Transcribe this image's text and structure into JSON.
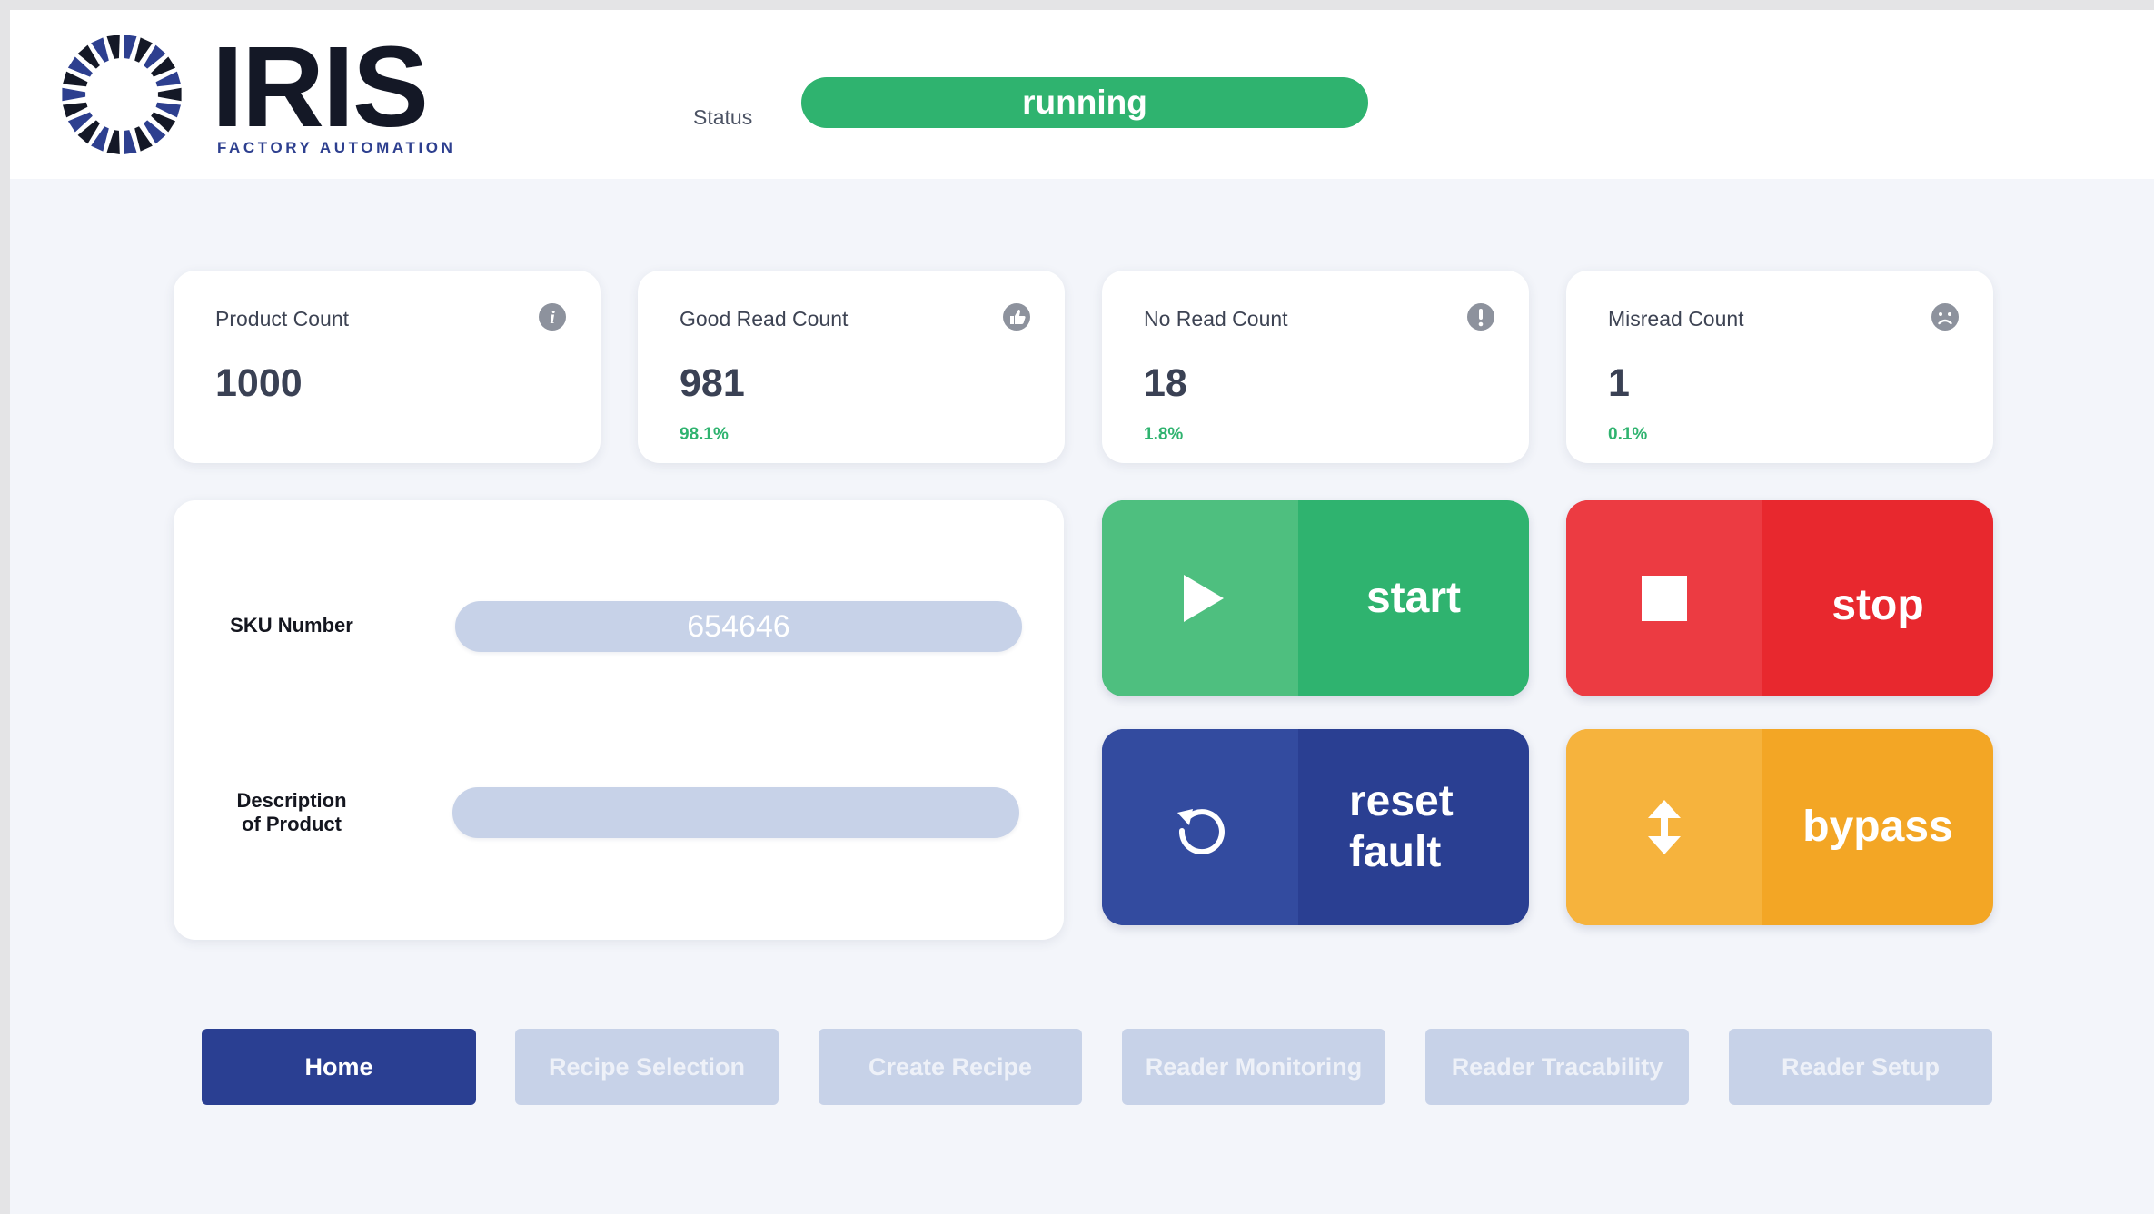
{
  "header": {
    "logo_word": "IRIS",
    "logo_sub": "FACTORY AUTOMATION",
    "status_label": "Status",
    "status_value": "running"
  },
  "metrics": [
    {
      "title": "Product Count",
      "value": "1000",
      "pct": "",
      "icon": "info-icon"
    },
    {
      "title": "Good Read Count",
      "value": "981",
      "pct": "98.1%",
      "icon": "thumbs-up-icon"
    },
    {
      "title": "No Read Count",
      "value": "18",
      "pct": "1.8%",
      "icon": "exclamation-icon"
    },
    {
      "title": "Misread Count",
      "value": "1",
      "pct": "0.1%",
      "icon": "sad-face-icon"
    }
  ],
  "form": {
    "sku_label": "SKU Number",
    "sku_value": "654646",
    "desc_label_line1": "Description",
    "desc_label_line2": "of Product",
    "desc_value": ""
  },
  "controls": {
    "start": "start",
    "stop": "stop",
    "reset_line1": "reset",
    "reset_line2": "fault",
    "bypass": "bypass"
  },
  "nav": [
    "Home",
    "Recipe Selection",
    "Create Recipe",
    "Reader Monitoring",
    "Reader Tracability",
    "Reader Setup"
  ],
  "colors": {
    "green": "#2fb36f",
    "red": "#e8282e",
    "blue": "#2a3f92",
    "orange": "#f3a625",
    "nav_inactive": "#c7d2e8"
  }
}
